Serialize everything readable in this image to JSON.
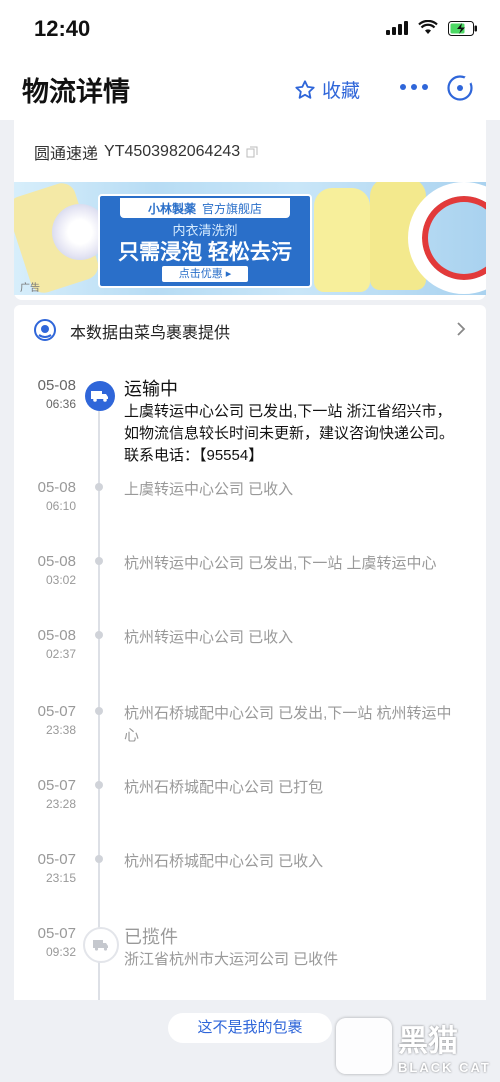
{
  "status_bar": {
    "time": "12:40"
  },
  "header": {
    "title": "物流详情",
    "favorite_label": "收藏"
  },
  "tracking": {
    "carrier": "圆通速递",
    "number": "YT4503982064243"
  },
  "banner": {
    "brand": "小林製薬",
    "store": "官方旗舰店",
    "subtitle": "内衣清洗剂",
    "headline": "只需浸泡  轻松去污",
    "cta": "点击优惠",
    "ad_tag": "广告"
  },
  "provider": {
    "text": "本数据由菜鸟裹裹提供"
  },
  "events": [
    {
      "date": "05-08",
      "time": "06:36",
      "status": "运输中",
      "desc": "上虞转运中心公司 已发出,下一站 浙江省绍兴市，如物流信息较长时间未更新，建议咨询快递公司。联系电话：【95554】"
    },
    {
      "date": "05-08",
      "time": "06:10",
      "status": "",
      "desc": "上虞转运中心公司 已收入"
    },
    {
      "date": "05-08",
      "time": "03:02",
      "status": "",
      "desc": "杭州转运中心公司 已发出,下一站 上虞转运中心"
    },
    {
      "date": "05-08",
      "time": "02:37",
      "status": "",
      "desc": "杭州转运中心公司 已收入"
    },
    {
      "date": "05-07",
      "time": "23:38",
      "status": "",
      "desc": "杭州石桥城配中心公司 已发出,下一站 杭州转运中心"
    },
    {
      "date": "05-07",
      "time": "23:28",
      "status": "",
      "desc": "杭州石桥城配中心公司 已打包"
    },
    {
      "date": "05-07",
      "time": "23:15",
      "status": "",
      "desc": "杭州石桥城配中心公司 已收入"
    },
    {
      "date": "05-07",
      "time": "09:32",
      "status": "已揽件",
      "desc": "浙江省杭州市大运河公司 已收件"
    }
  ],
  "footer": {
    "not_mine_label": "这不是我的包裹"
  },
  "watermark": {
    "name": "黑猫",
    "english": "BLACK CAT"
  },
  "colors": {
    "accent": "#2f66d9",
    "muted": "#999999"
  }
}
